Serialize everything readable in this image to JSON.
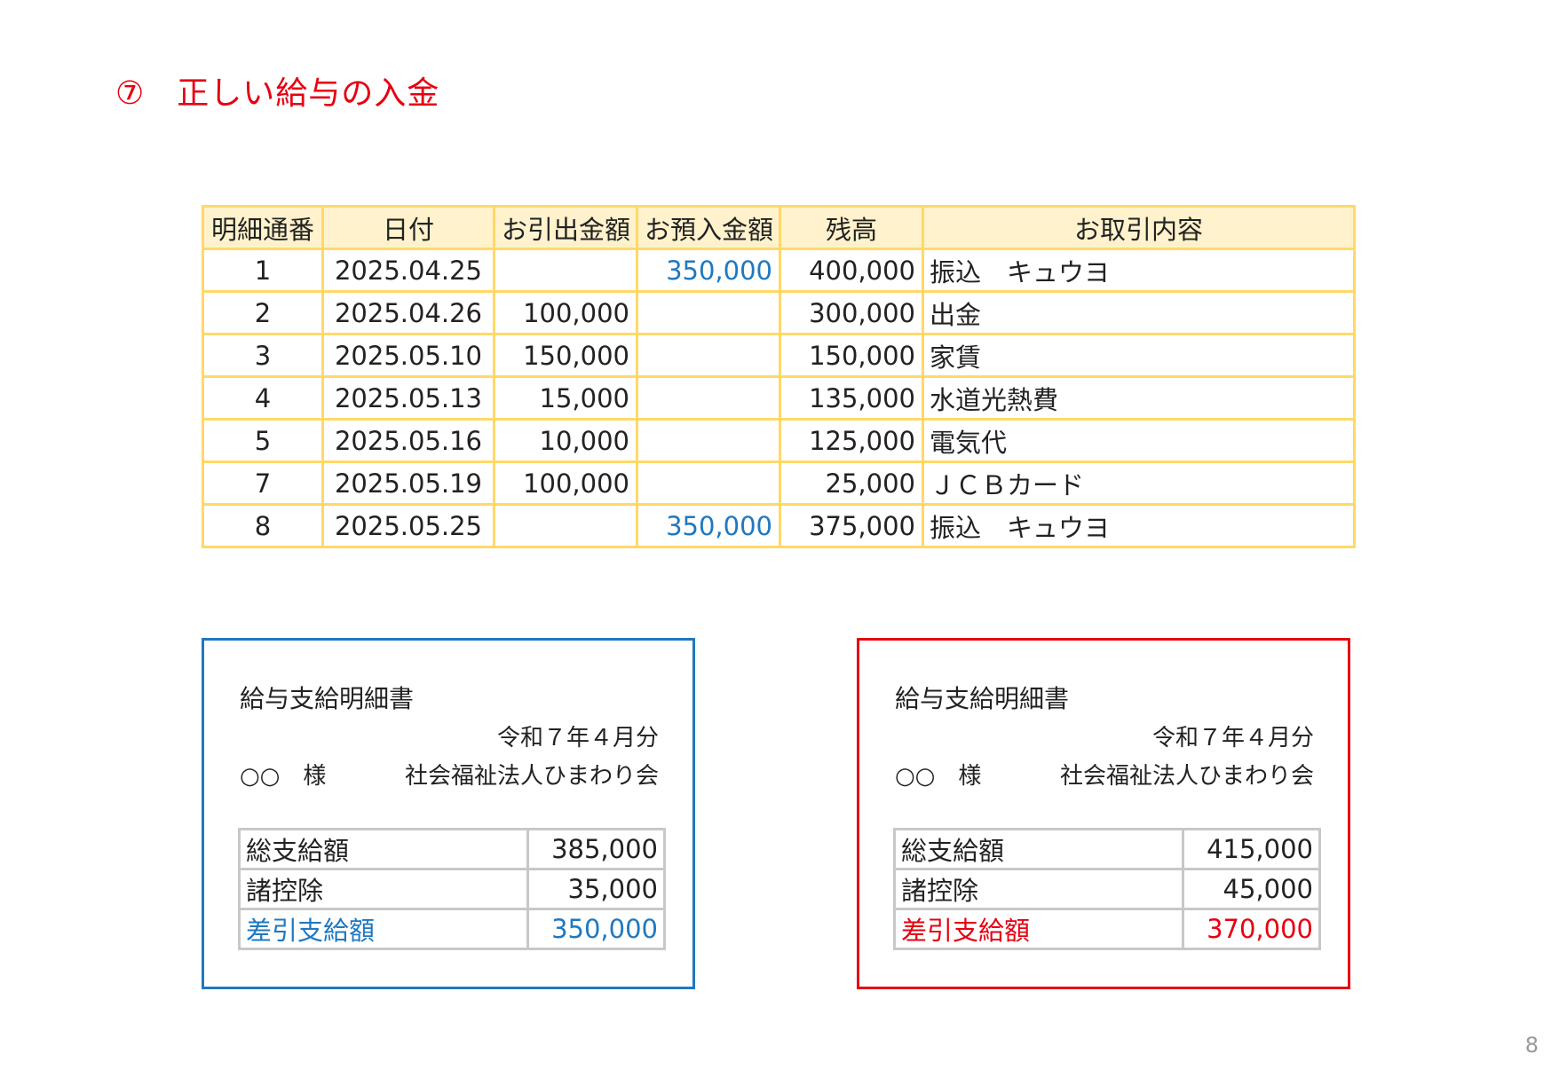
{
  "title": {
    "number": "⑦",
    "text": "正しい給与の入金"
  },
  "statement": {
    "headers": [
      "明細通番",
      "日付",
      "お引出金額",
      "お預入金額",
      "残高",
      "お取引内容"
    ],
    "rows": [
      [
        "1",
        "2025.04.25",
        "",
        "350,000",
        "400,000",
        "振込　キュウヨ"
      ],
      [
        "2",
        "2025.04.26",
        "100,000",
        "",
        "300,000",
        "出金"
      ],
      [
        "3",
        "2025.05.10",
        "150,000",
        "",
        "150,000",
        "家賃"
      ],
      [
        "4",
        "2025.05.13",
        "15,000",
        "",
        "135,000",
        "水道光熱費"
      ],
      [
        "5",
        "2025.05.16",
        "10,000",
        "",
        "125,000",
        "電気代"
      ],
      [
        "7",
        "2025.05.19",
        "100,000",
        "",
        "25,000",
        "ＪＣＢカード"
      ],
      [
        "8",
        "2025.05.25",
        "",
        "350,000",
        "375,000",
        "振込　キュウヨ"
      ]
    ]
  },
  "payslips": [
    {
      "title": "給与支給明細書",
      "period": "令和７年４月分",
      "recipient": "○○　様",
      "employer": "社会福祉法人ひまわり会",
      "rows": [
        {
          "label": "総支給額",
          "amount": "385,000"
        },
        {
          "label": "諸控除",
          "amount": "35,000"
        },
        {
          "label": "差引支給額",
          "amount": "350,000"
        }
      ],
      "border_color": "#1f78c1"
    },
    {
      "title": "給与支給明細書",
      "period": "令和７年４月分",
      "recipient": "○○　様",
      "employer": "社会福祉法人ひまわり会",
      "rows": [
        {
          "label": "総支給額",
          "amount": "415,000"
        },
        {
          "label": "諸控除",
          "amount": "45,000"
        },
        {
          "label": "差引支給額",
          "amount": "370,000"
        }
      ],
      "border_color": "#e60012"
    }
  ],
  "page_number": "8",
  "colors": {
    "title": "#e60012",
    "deposit": "#1f78c1",
    "header_fill": "#fff2cc",
    "table_border": "#ffd966"
  }
}
